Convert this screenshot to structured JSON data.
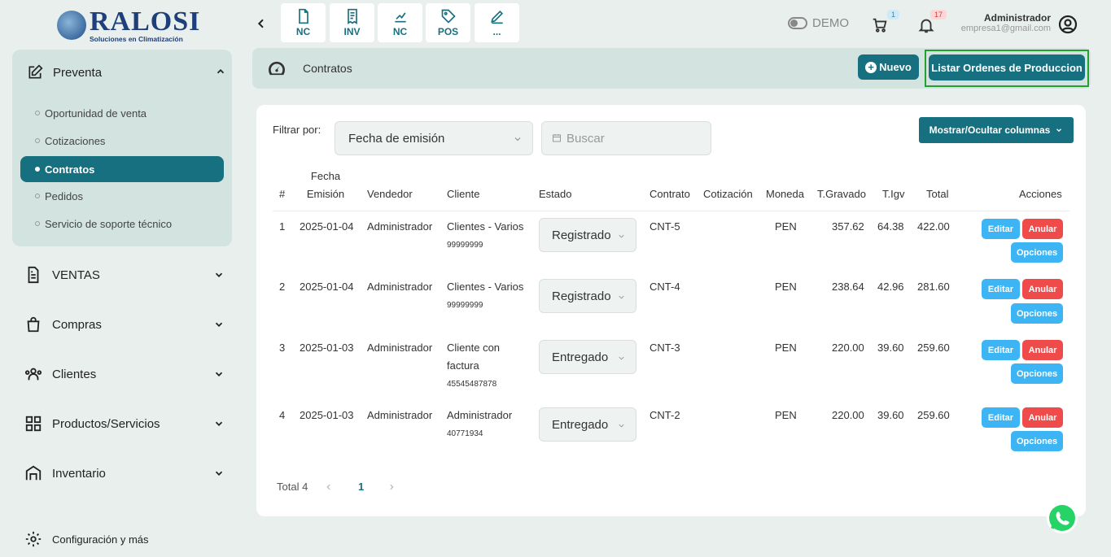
{
  "brand": {
    "name": "RALOSI",
    "tagline": "Soluciones en Climatización"
  },
  "sidebar": {
    "group": {
      "label": "Preventa",
      "items": [
        {
          "label": "Oportunidad de venta"
        },
        {
          "label": "Cotizaciones"
        },
        {
          "label": "Contratos",
          "active": true
        },
        {
          "label": "Pedidos"
        },
        {
          "label": "Servicio de soporte técnico"
        }
      ]
    },
    "sections": [
      {
        "label": "VENTAS",
        "icon": "document-icon"
      },
      {
        "label": "Compras",
        "icon": "bag-icon"
      },
      {
        "label": "Clientes",
        "icon": "users-icon"
      },
      {
        "label": "Productos/Servicios",
        "icon": "grid-icon"
      },
      {
        "label": "Inventario",
        "icon": "warehouse-icon"
      }
    ],
    "config_label": "Configuración y más"
  },
  "topbar": {
    "quick_actions": [
      {
        "label": "NC",
        "icon": "file-icon"
      },
      {
        "label": "INV",
        "icon": "receipt-icon"
      },
      {
        "label": "NC",
        "icon": "chart-icon"
      },
      {
        "label": "POS",
        "icon": "tag-icon"
      },
      {
        "label": "...",
        "icon": "pencil-icon"
      }
    ],
    "demo_label": "DEMO",
    "cart_badge": "1",
    "notifications_badge": "17",
    "user_name": "Administrador",
    "user_email": "empresa1@gmail.com"
  },
  "header": {
    "title": "Contratos",
    "new_button": "Nuevo",
    "list_orders_button": "Listar Ordenes de Produccion"
  },
  "filters": {
    "label": "Filtrar por:",
    "field_value": "Fecha de emisión",
    "search_placeholder": "Buscar",
    "columns_button": "Mostrar/Ocultar columnas"
  },
  "table": {
    "headers": {
      "num": "#",
      "fecha_1": "Fecha",
      "fecha_2": "Emisión",
      "vendedor": "Vendedor",
      "cliente": "Cliente",
      "estado": "Estado",
      "contrato": "Contrato",
      "cotizacion": "Cotización",
      "moneda": "Moneda",
      "gravado": "T.Gravado",
      "igv": "T.Igv",
      "total": "Total",
      "acciones": "Acciones"
    },
    "rows": [
      {
        "num": "1",
        "fecha": "2025-01-04",
        "vendedor": "Administrador",
        "cliente_1": "Clientes - Varios",
        "cliente_2": "",
        "doc": "99999999",
        "estado": "Registrado",
        "contrato": "CNT-5",
        "moneda": "PEN",
        "gravado": "357.62",
        "igv": "64.38",
        "total": "422.00"
      },
      {
        "num": "2",
        "fecha": "2025-01-04",
        "vendedor": "Administrador",
        "cliente_1": "Clientes - Varios",
        "cliente_2": "",
        "doc": "99999999",
        "estado": "Registrado",
        "contrato": "CNT-4",
        "moneda": "PEN",
        "gravado": "238.64",
        "igv": "42.96",
        "total": "281.60"
      },
      {
        "num": "3",
        "fecha": "2025-01-03",
        "vendedor": "Administrador",
        "cliente_1": "Cliente con",
        "cliente_2": "factura",
        "doc": "45545487878",
        "estado": "Entregado",
        "contrato": "CNT-3",
        "moneda": "PEN",
        "gravado": "220.00",
        "igv": "39.60",
        "total": "259.60"
      },
      {
        "num": "4",
        "fecha": "2025-01-03",
        "vendedor": "Administrador",
        "cliente_1": "Administrador",
        "cliente_2": "",
        "doc": "40771934",
        "estado": "Entregado",
        "contrato": "CNT-2",
        "moneda": "PEN",
        "gravado": "220.00",
        "igv": "39.60",
        "total": "259.60"
      }
    ],
    "actions": {
      "edit": "Editar",
      "cancel": "Anular",
      "options": "Opciones"
    }
  },
  "pagination": {
    "total_label": "Total 4",
    "current_page": "1"
  }
}
